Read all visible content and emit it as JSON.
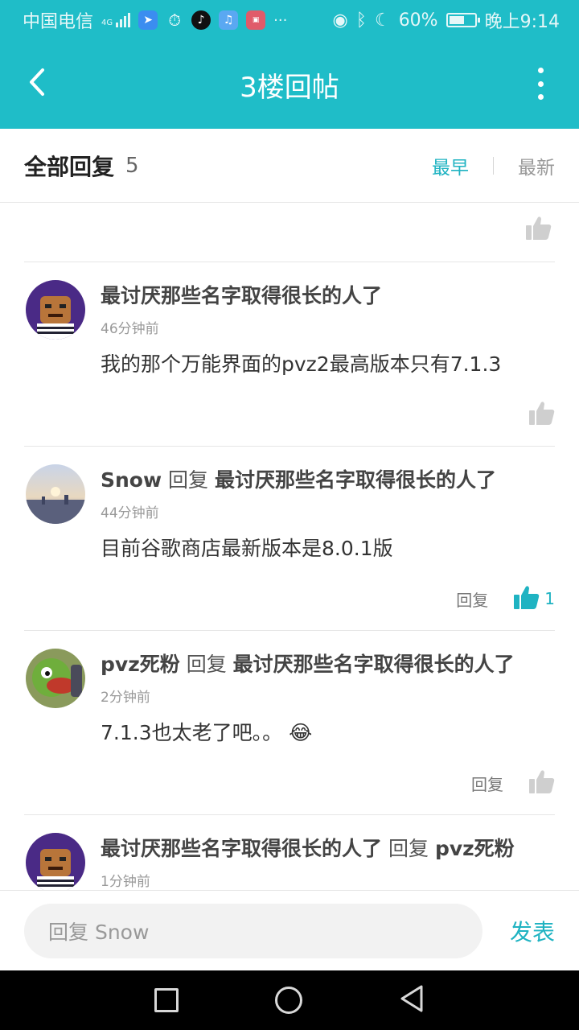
{
  "statusbar": {
    "carrier": "中国电信",
    "network": "4G",
    "battery": "60%",
    "battery_fraction": 0.6,
    "time": "晚上9:14",
    "icons": [
      "signal-icon",
      "app-notification-icon",
      "timer-icon",
      "tiktok-icon",
      "music-icon",
      "huawei-appgallery-icon",
      "more-notifications-icon",
      "eye-comfort-icon",
      "bluetooth-icon",
      "do-not-disturb-icon",
      "battery-icon"
    ]
  },
  "appbar": {
    "title": "3楼回帖",
    "back_icon": "chevron-left-icon",
    "more_icon": "more-vertical-icon"
  },
  "sort": {
    "heading": "全部回复",
    "count": "5",
    "earliest": "最早",
    "latest": "最新",
    "active": "earliest"
  },
  "replies": [
    {
      "user": "最讨厌那些名字取得很长的人了",
      "reply_word": "",
      "target": "",
      "time": "46分钟前",
      "content": "我的那个万能界面的pvz2最高版本只有7.1.3",
      "reply_label": "",
      "likes": ""
    },
    {
      "user": "Snow",
      "reply_word": "回复",
      "target": "最讨厌那些名字取得很长的人了",
      "time": "44分钟前",
      "content": "目前谷歌商店最新版本是8.0.1版",
      "reply_label": "回复",
      "likes": "1"
    },
    {
      "user": "pvz死粉",
      "reply_word": "回复",
      "target": "最讨厌那些名字取得很长的人了",
      "time": "2分钟前",
      "content": "7.1.3也太老了吧。。",
      "emoji": "😂",
      "reply_label": "回复",
      "likes": ""
    },
    {
      "user": "最讨厌那些名字取得很长的人了",
      "reply_word": "回复",
      "target": "pvz死粉",
      "time": "1分钟前"
    }
  ],
  "composer": {
    "placeholder": "回复 Snow",
    "send": "发表"
  },
  "colors": {
    "accent": "#1fbdc8",
    "link": "#1fb3c2"
  }
}
